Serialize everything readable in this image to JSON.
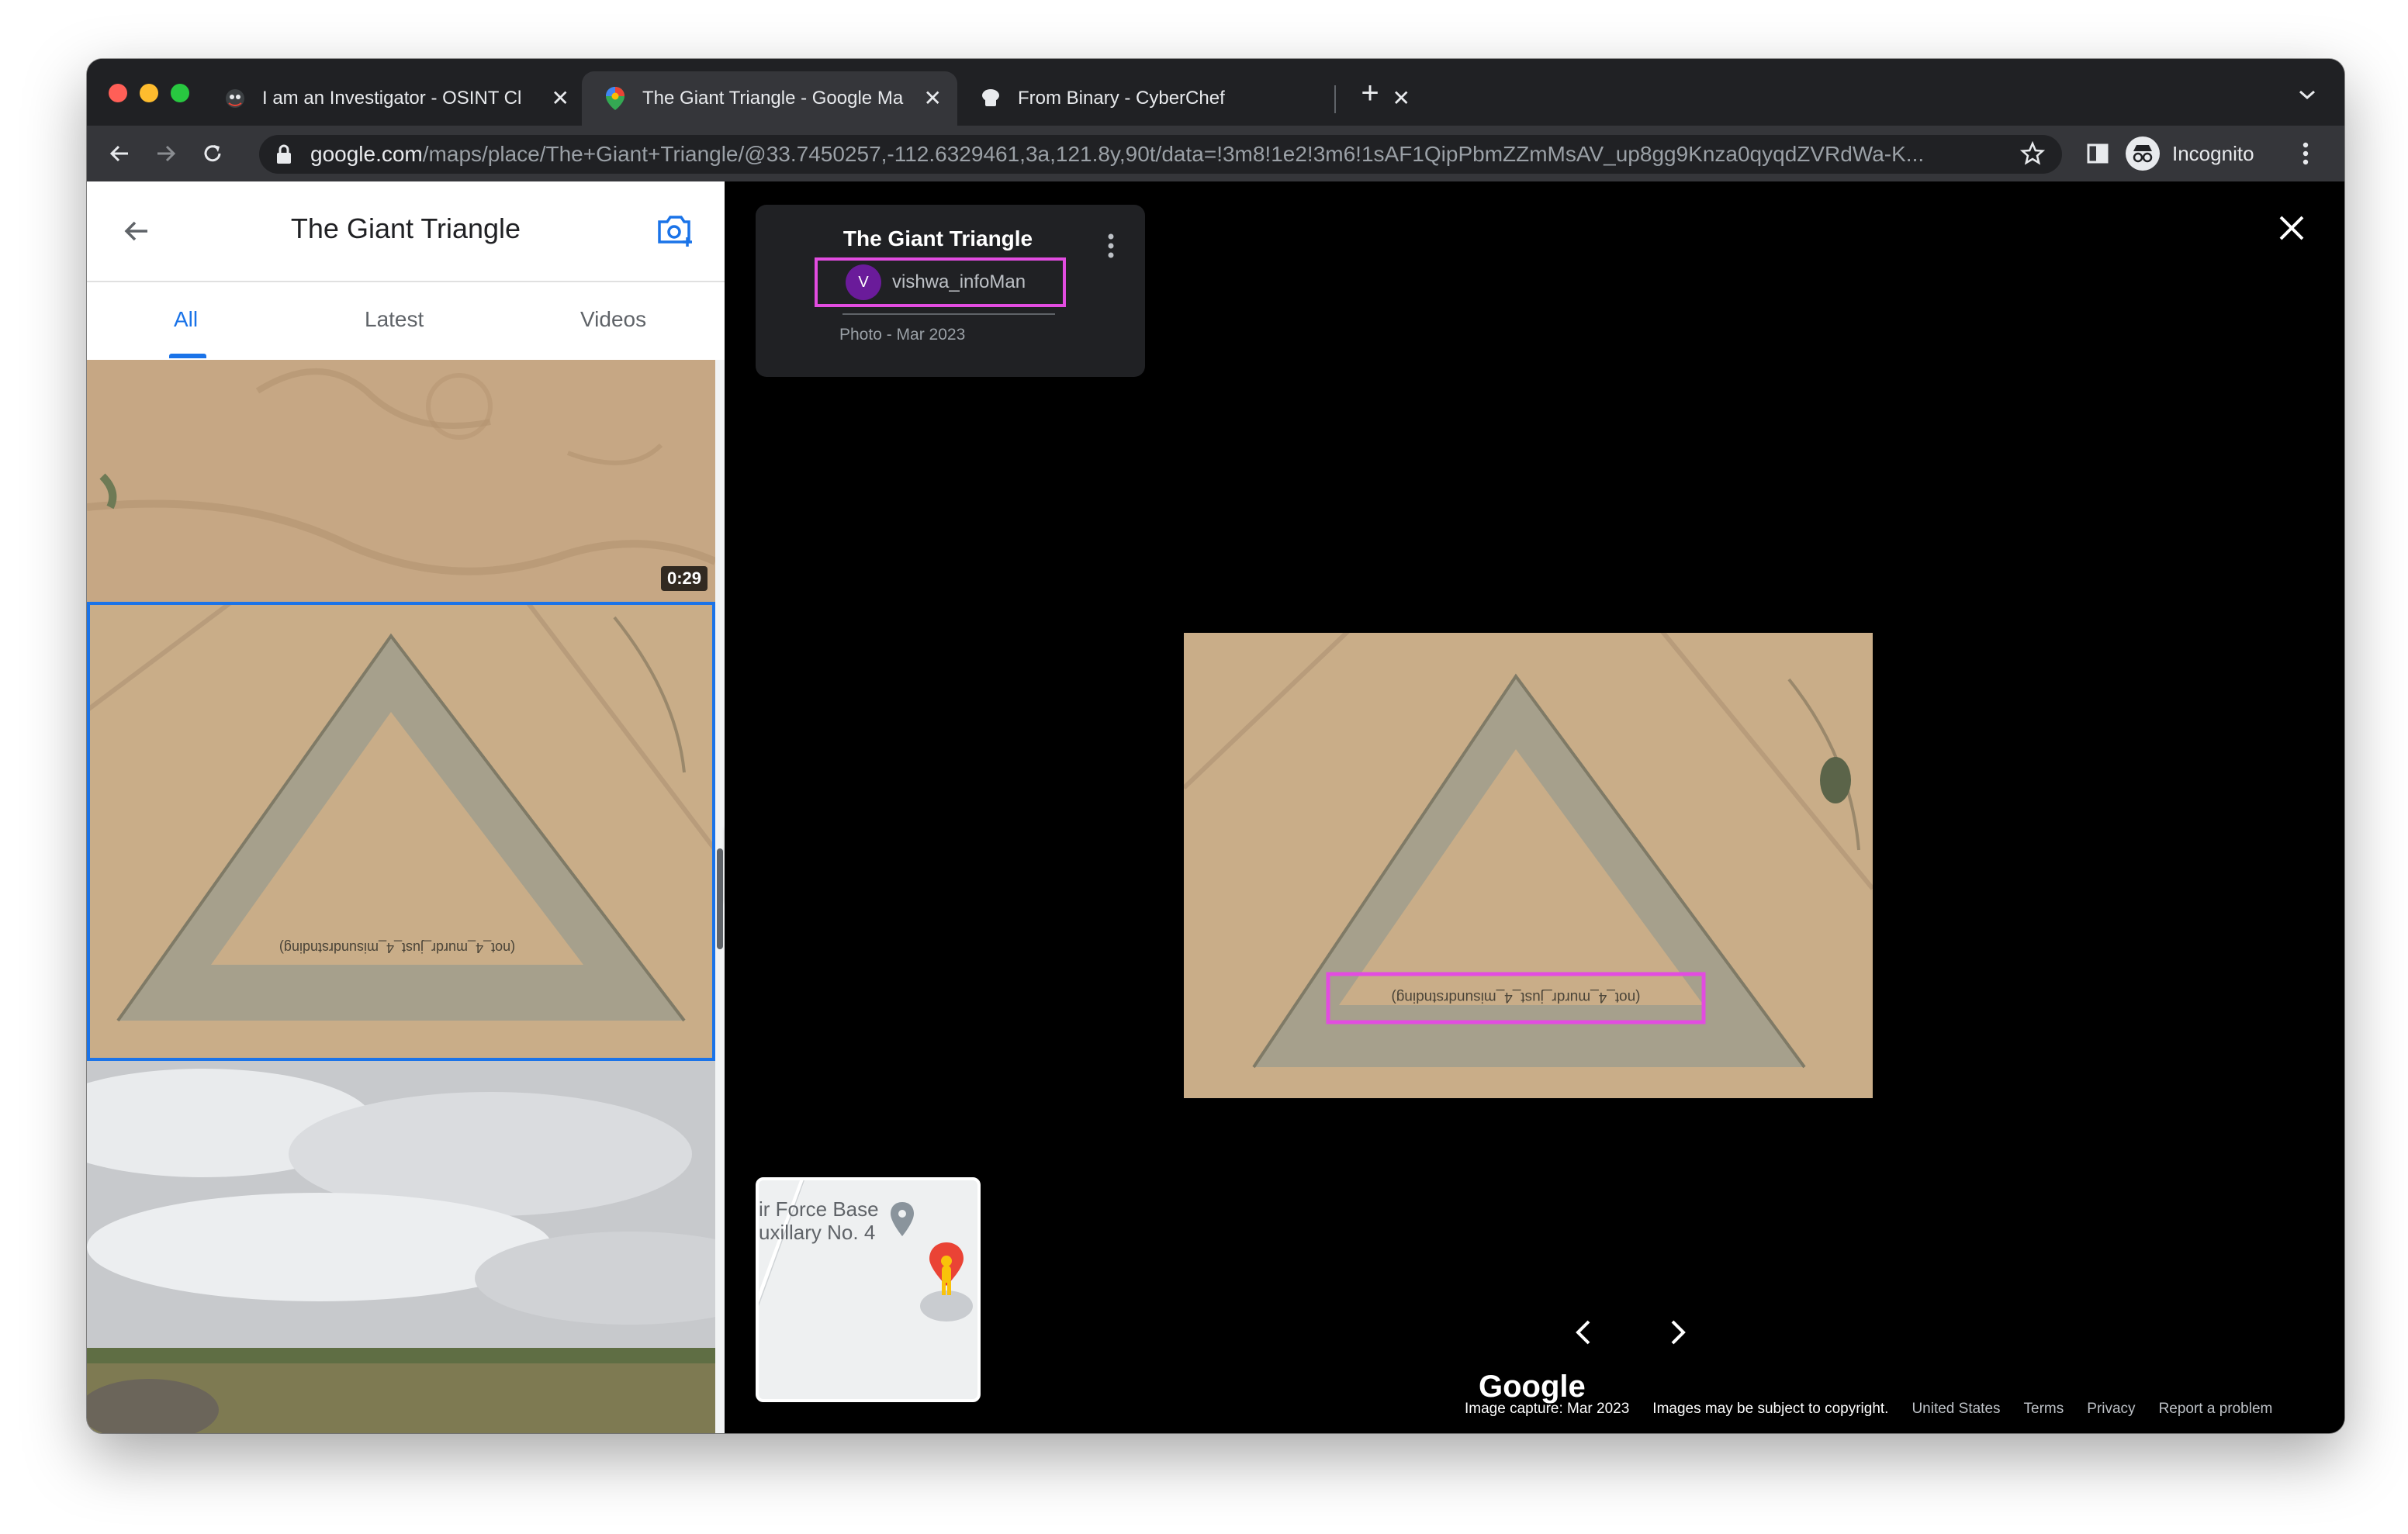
{
  "browser": {
    "tabs": [
      {
        "title": "I am an Investigator - OSINT Cl",
        "favicon": "osint-favicon"
      },
      {
        "title": "The Giant Triangle - Google Ma",
        "favicon": "google-maps-pin-favicon"
      },
      {
        "title": "From Binary - CyberChef",
        "favicon": "cyberchef-hat-favicon"
      }
    ],
    "url_domain": "google.com",
    "url_path": "/maps/place/The+Giant+Triangle/@33.7450257,-112.6329461,3a,121.8y,90t/data=!3m8!1e2!3m6!1sAF1QipPbmZZmMsAV_up8gg9Knza0qyqdZVRdWa-K...",
    "profile_label": "Incognito"
  },
  "side_panel": {
    "title": "The Giant Triangle",
    "tabs": [
      "All",
      "Latest",
      "Videos"
    ],
    "active_tab": "All",
    "video_duration": "0:29"
  },
  "viewer": {
    "place_title": "The Giant Triangle",
    "author_initial": "V",
    "author_name": "vishwa_infoMan",
    "photo_meta": "Photo - Mar 2023",
    "photo_caption_text": "(not_4_murdr_just_4_misundrstnding)",
    "minimap_labels": [
      "ir Force Base",
      "uxillary No. 4"
    ],
    "logo": "Google",
    "footer": {
      "capture": "Image capture: Mar 2023",
      "copyright": "Images may be subject to copyright.",
      "country": "United States",
      "terms": "Terms",
      "privacy": "Privacy",
      "report": "Report a problem"
    }
  },
  "colors": {
    "highlight": "#e24ce0",
    "accent": "#1a73e8",
    "sand": "#c9ad88"
  }
}
